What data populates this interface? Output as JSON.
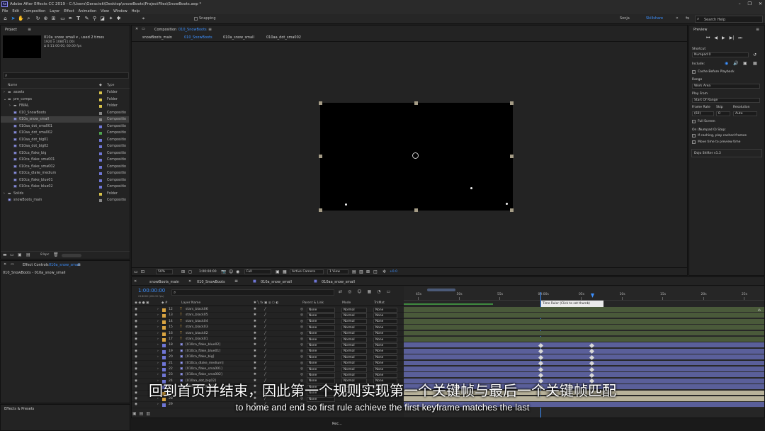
{
  "app": {
    "title": "Adobe After Effects CC 2019 - C:\\Users\\Geraciek\\Desktop\\snowBoots\\ProjectFiles\\SnowBoots.aep *",
    "logo": "Ae"
  },
  "window_controls": [
    "–",
    "❐",
    "✕"
  ],
  "menu": [
    "File",
    "Edit",
    "Composition",
    "Layer",
    "Effect",
    "Animation",
    "View",
    "Window",
    "Help"
  ],
  "toolbar": {
    "snapping": "Snapping",
    "user": "Sonja",
    "workspace": "Skillshare",
    "search_placeholder": "Search Help"
  },
  "project": {
    "tab": "Project",
    "item_name": "010a_snow_small ▾ , used 2 times",
    "item_dims": "1920 x 1080 (1.00)",
    "item_duration": "Δ 0:11:00:00, 60.00 fps",
    "search_placeholder": "",
    "col_name": "Name",
    "col_type": "Type",
    "bpc": "8 bpc",
    "items": [
      {
        "name": "assets",
        "type": "Folder",
        "color": "#d9c34a",
        "indent": 0,
        "twirl": "›",
        "icon": "folder"
      },
      {
        "name": "pre_comps",
        "type": "Folder",
        "color": "#d9c34a",
        "indent": 0,
        "twirl": "⌄",
        "icon": "folder"
      },
      {
        "name": "FINAL",
        "type": "Folder",
        "color": "#d9c34a",
        "indent": 1,
        "twirl": "›",
        "icon": "folder"
      },
      {
        "name": "010_SnowBoots",
        "type": "Compositio",
        "color": "#888888",
        "indent": 1,
        "twirl": "",
        "icon": "comp"
      },
      {
        "name": "010a_snow_small",
        "type": "Compositio",
        "color": "#888888",
        "indent": 1,
        "twirl": "",
        "icon": "comp",
        "selected": true
      },
      {
        "name": "010aa_dot_sma001",
        "type": "Compositio",
        "color": "#6f76d6",
        "indent": 1,
        "twirl": "",
        "icon": "comp"
      },
      {
        "name": "010aa_dot_sma002",
        "type": "Compositio",
        "color": "#4fa44f",
        "indent": 1,
        "twirl": "",
        "icon": "comp"
      },
      {
        "name": "010aa_dot_big01",
        "type": "Compositio",
        "color": "#6f76d6",
        "indent": 1,
        "twirl": "",
        "icon": "comp"
      },
      {
        "name": "010aa_dot_big02",
        "type": "Compositio",
        "color": "#6f76d6",
        "indent": 1,
        "twirl": "",
        "icon": "comp"
      },
      {
        "name": "010ca_flake_big",
        "type": "Compositio",
        "color": "#6f76d6",
        "indent": 1,
        "twirl": "",
        "icon": "comp"
      },
      {
        "name": "010ca_flake_sma001",
        "type": "Compositio",
        "color": "#6f76d6",
        "indent": 1,
        "twirl": "",
        "icon": "comp"
      },
      {
        "name": "010ca_flake_sma002",
        "type": "Compositio",
        "color": "#6f76d6",
        "indent": 1,
        "twirl": "",
        "icon": "comp"
      },
      {
        "name": "010ca_dlake_medium",
        "type": "Compositio",
        "color": "#6f76d6",
        "indent": 1,
        "twirl": "",
        "icon": "comp"
      },
      {
        "name": "010ca_flake_blue01",
        "type": "Compositio",
        "color": "#6f76d6",
        "indent": 1,
        "twirl": "",
        "icon": "comp"
      },
      {
        "name": "010ca_flake_blue02",
        "type": "Compositio",
        "color": "#6f76d6",
        "indent": 1,
        "twirl": "",
        "icon": "comp"
      },
      {
        "name": "Solids",
        "type": "Folder",
        "color": "#d9c34a",
        "indent": 0,
        "twirl": "›",
        "icon": "folder"
      },
      {
        "name": "snowBoots_main",
        "type": "Compositio",
        "color": "#888888",
        "indent": 0,
        "twirl": "",
        "icon": "comp"
      }
    ]
  },
  "effect_controls": {
    "tab": "Effect Controls",
    "tab_target": "010a_snow_small",
    "path": "010_SnowBoots - 010a_snow_small"
  },
  "effects_presets": {
    "tab": "Effects & Presets"
  },
  "composition": {
    "tab": "Composition",
    "tab_target": "010_SnowBoots",
    "crumbs": [
      "snowBoots_main",
      "010_SnowBoots",
      "010a_snow_small",
      "010aa_dot_sma002"
    ],
    "zoom": "50%",
    "timecode": "1:00:00:00",
    "resolution": "Full",
    "camera": "Active Camera",
    "views": "1 View",
    "exposure": "+0.0"
  },
  "preview": {
    "title": "Preview",
    "shortcut_label": "Shortcut",
    "shortcut_value": "Numpad 0",
    "include_label": "Include:",
    "cache_label": "Cache Before Playback",
    "range_label": "Range",
    "range_value": "Work Area",
    "playfrom_label": "Play From",
    "playfrom_value": "Start Of Range",
    "framerate_label": "Frame Rate",
    "skip_label": "Skip",
    "resolution_label": "Resolution",
    "framerate_value": "(60)",
    "skip_value": "0",
    "resolution_value": "Auto",
    "fullscreen_label": "Full Screen",
    "stop_label": "On (Numpad 0) Stop:",
    "ifcaching_label": "If caching, play cached frames",
    "movetime_label": "Move time to preview time",
    "plugin": "Dojo Shifter v1.3"
  },
  "timeline": {
    "tabs": [
      "snowBoots_main",
      "010_SnowBoots",
      "010a_snow_small",
      "010aa_snow_small"
    ],
    "active_tab": 1,
    "timecode": "1:00:00:00",
    "timecode_sub": "216000 (60.00 fps)",
    "search_placeholder": "",
    "col_layer": "Layer Name",
    "col_parent": "Parent & Link",
    "col_mode": "Mode",
    "col_trkmat": "TrkMat",
    "ruler": [
      "45s",
      "50s",
      "55s",
      "00:00s",
      "05s",
      "10s",
      "15s",
      "20s",
      "25s"
    ],
    "tooltip": "Time Ruler (Click to set thumb)",
    "layers": [
      {
        "num": "12",
        "name": "stars_black06",
        "color": "#d9a441",
        "icon": "T",
        "mode": "Normal",
        "parent": "None",
        "trkmat": "None",
        "bar": "#4a5a3a"
      },
      {
        "num": "13",
        "name": "stars_black05",
        "color": "#d9a441",
        "icon": "T",
        "mode": "Normal",
        "parent": "None",
        "trkmat": "None",
        "bar": "#4a5a3a"
      },
      {
        "num": "14",
        "name": "stars_black04",
        "color": "#d9a441",
        "icon": "T",
        "mode": "Normal",
        "parent": "None",
        "trkmat": "None",
        "bar": "#4a5a3a"
      },
      {
        "num": "15",
        "name": "stars_black03",
        "color": "#d9a441",
        "icon": "T",
        "mode": "Normal",
        "parent": "None",
        "trkmat": "None",
        "bar": "#4a5a3a"
      },
      {
        "num": "16",
        "name": "stars_black02",
        "color": "#d9a441",
        "icon": "T",
        "mode": "Normal",
        "parent": "None",
        "trkmat": "None",
        "bar": "#4a5a3a"
      },
      {
        "num": "17",
        "name": "stars_black01",
        "color": "#d9a441",
        "icon": "T",
        "mode": "Normal",
        "parent": "None",
        "trkmat": "None",
        "bar": "#4a5a3a"
      },
      {
        "num": "18",
        "name": "[010ca_flake_blue02]",
        "color": "#6f76d6",
        "icon": "▣",
        "mode": "Normal",
        "parent": "None",
        "trkmat": "None",
        "bar": "#5a5f9a"
      },
      {
        "num": "19",
        "name": "[010ca_flake_blue01]",
        "color": "#6f76d6",
        "icon": "▣",
        "mode": "Normal",
        "parent": "None",
        "trkmat": "None",
        "bar": "#5a5f9a"
      },
      {
        "num": "20",
        "name": "[010ca_flake_big]",
        "color": "#6f76d6",
        "icon": "▣",
        "mode": "Normal",
        "parent": "None",
        "trkmat": "None",
        "bar": "#5a5f9a"
      },
      {
        "num": "21",
        "name": "[010ca_dlake_medium]",
        "color": "#6f76d6",
        "icon": "▣",
        "mode": "Normal",
        "parent": "None",
        "trkmat": "None",
        "bar": "#5a5f9a"
      },
      {
        "num": "22",
        "name": "[010ca_flake_sma001]",
        "color": "#6f76d6",
        "icon": "▣",
        "mode": "Normal",
        "parent": "None",
        "trkmat": "None",
        "bar": "#5a5f9a"
      },
      {
        "num": "23",
        "name": "[010ca_flake_sma002]",
        "color": "#6f76d6",
        "icon": "▣",
        "mode": "Normal",
        "parent": "None",
        "trkmat": "None",
        "bar": "#5a5f9a"
      },
      {
        "num": "24",
        "name": "[010aa_dot_big02]",
        "color": "#6f76d6",
        "icon": "▣",
        "mode": "Normal",
        "parent": "None",
        "trkmat": "None",
        "bar": "#5a5f9a"
      },
      {
        "num": "25",
        "name": "[010aa_dot_big01]",
        "color": "#6f76d6",
        "icon": "▣",
        "mode": "Normal",
        "parent": "None",
        "trkmat": "None",
        "bar": "#5a5f9a"
      },
      {
        "num": "26",
        "name": "",
        "color": "#d9a441",
        "icon": "",
        "mode": "Normal",
        "parent": "None",
        "trkmat": "None",
        "bar": "#b8b29a"
      },
      {
        "num": "28",
        "name": "",
        "color": "#d9a441",
        "icon": "",
        "mode": "",
        "parent": "None",
        "trkmat": "",
        "bar": "#b8b29a"
      },
      {
        "num": "29",
        "name": "",
        "color": "#6f76d6",
        "icon": "",
        "mode": "",
        "parent": "",
        "trkmat": "",
        "bar": "#5a5f9a"
      }
    ]
  },
  "subtitles": {
    "zh": "回到首页并结束，因此第一个规则实现第一个关键帧与最后一个关键帧匹配",
    "en": "to home and end so first rule achieve the first keyframe matches the last"
  },
  "taskbar": {
    "label": "Rec..."
  }
}
